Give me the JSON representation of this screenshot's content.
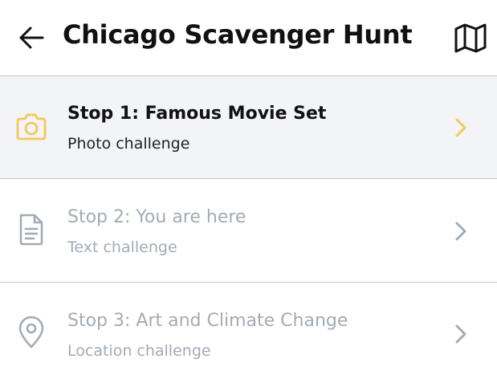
{
  "header": {
    "title": "Chicago Scavenger Hunt",
    "back_icon": "arrow-left-icon",
    "map_icon": "map-icon"
  },
  "colors": {
    "accent": "#f5c75a",
    "active_background": "#f3f4f7",
    "inactive_text": "#a3abb5",
    "divider": "#c8c8c8"
  },
  "stops": [
    {
      "title": "Stop 1: Famous Movie Set",
      "type": "Photo challenge",
      "icon": "camera-icon",
      "state": "active"
    },
    {
      "title": "Stop 2: You are here",
      "type": "Text challenge",
      "icon": "document-icon",
      "state": "inactive"
    },
    {
      "title": "Stop 3: Art and Climate Change",
      "type": "Location challenge",
      "icon": "location-pin-icon",
      "state": "inactive"
    }
  ]
}
